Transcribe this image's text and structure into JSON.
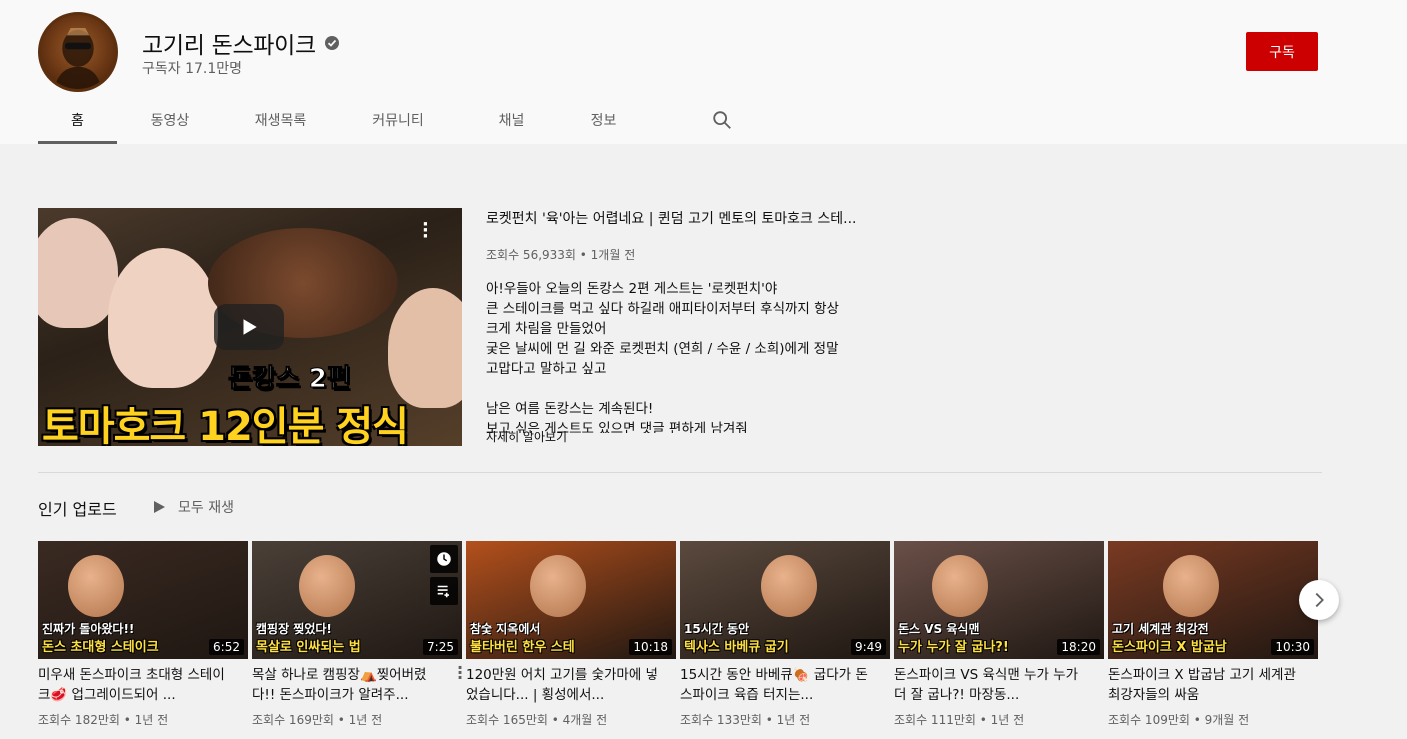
{
  "channel": {
    "name": "고기리 돈스파이크",
    "subscribers": "구독자 17.1만명",
    "subscribe_label": "구독"
  },
  "tabs": [
    {
      "label": "홈",
      "active": true
    },
    {
      "label": "동영상"
    },
    {
      "label": "재생목록"
    },
    {
      "label": "커뮤니티"
    },
    {
      "label": "채널"
    },
    {
      "label": "정보"
    }
  ],
  "featured": {
    "title": "로켓펀치 '육'아는 어렵네요 | 퀸덤 고기 멘토의 토마호크 스테...",
    "meta": "조회수 56,933회 • 1개월 전",
    "thumb_line1": "돈캉스 2편",
    "thumb_line2": "토마호크 12인분 정식",
    "description": [
      "아!우들아 오늘의 돈캉스 2편 게스트는 '로켓펀치'야",
      "큰 스테이크를 먹고 싶다 하길래 애피타이저부터 후식까지 항상",
      "크게 차림을 만들었어",
      "궂은 날씨에 먼 길 와준 로켓펀치 (연희 / 수윤 / 소희)에게  정말",
      "고맙다고 말하고 싶고",
      "",
      "남은 여름 돈캉스는 계속된다!",
      "보고 싶은 게스트도 있으면 댓글 편하게 남겨줘"
    ],
    "read_more": "자세히 알아보기"
  },
  "popular": {
    "title": "인기 업로드",
    "play_all": "모두 재생",
    "videos": [
      {
        "title": "미우새 돈스파이크 초대형 스테이크🥩 업그레이드되어 ...",
        "meta": "조회수 182만회 • 1년 전",
        "duration": "6:52",
        "cap": "돈스 초대형 스테이크",
        "cap2": "진짜가 돌아왔다!!",
        "bg": "#3a2a22"
      },
      {
        "title": "목살 하나로 캠핑장⛺찢어버렸다!! 돈스파이크가 알려주...",
        "meta": "조회수 169만회 • 1년 전",
        "duration": "7:25",
        "cap": "목살로 인싸되는 법",
        "cap2": "캠핑장 찢었다!",
        "bg": "#4a4038"
      },
      {
        "title": "120만원 어치 고기를 숯가마에 넣었습니다... | 횡성에서...",
        "meta": "조회수 165만회 • 4개월 전",
        "duration": "10:18",
        "cap": "불타버린 한우 스테",
        "cap2": "참숯 지옥에서",
        "bg": "#b4501c"
      },
      {
        "title": "15시간 동안 바베큐🍖 굽다가 돈스파이크 육즙 터지는...",
        "meta": "조회수 133만회 • 1년 전",
        "duration": "9:49",
        "cap": "텍사스 바베큐 굽기",
        "cap2": "15시간 동안",
        "bg": "#5b4a3e"
      },
      {
        "title": "돈스파이크 VS 육식맨 누가 누가 더 잘 굽나?! 마장동...",
        "meta": "조회수 111만회 • 1년 전",
        "duration": "18:20",
        "cap": "누가 누가 잘 굽나?!",
        "cap2": "돈스 VS 육식맨",
        "bg": "#6a5048"
      },
      {
        "title": "돈스파이크 X 밥굽남 고기 세계관 최강자들의 싸움",
        "meta": "조회수 109만회 • 9개월 전",
        "duration": "10:30",
        "cap": "돈스파이크 X 밥굽남",
        "cap2": "고기 세계관 최강전",
        "bg": "#7a3a22"
      }
    ]
  }
}
